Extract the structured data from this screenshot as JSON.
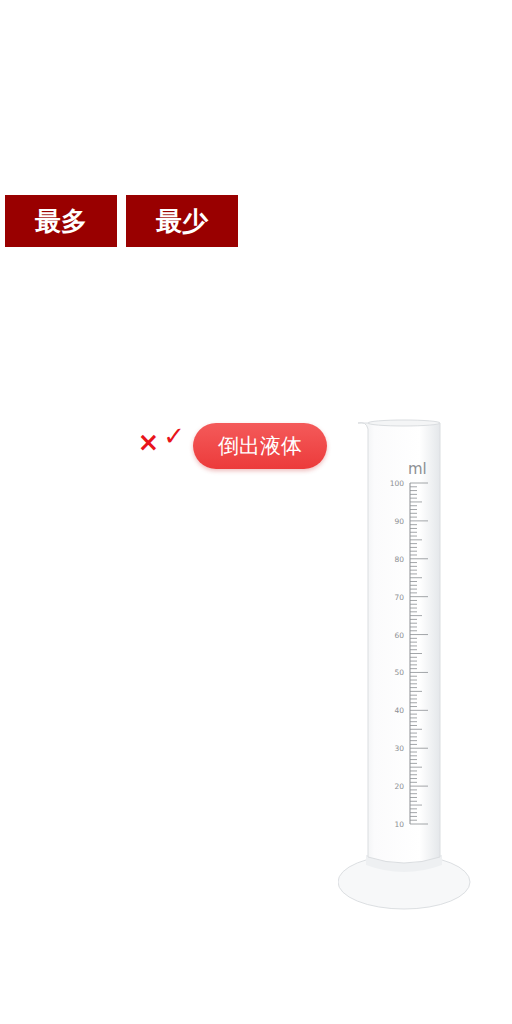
{
  "mode_buttons": [
    {
      "label": "最多"
    },
    {
      "label": "最少"
    }
  ],
  "marks": [
    {
      "symbol": "×"
    },
    {
      "symbol": "✓"
    }
  ],
  "pour_button": {
    "label": "倒出液体"
  },
  "cylinder": {
    "unit": "ml",
    "scale": [
      "100",
      "90",
      "80",
      "70",
      "60",
      "50",
      "40",
      "30",
      "20",
      "10"
    ],
    "level": 0
  }
}
